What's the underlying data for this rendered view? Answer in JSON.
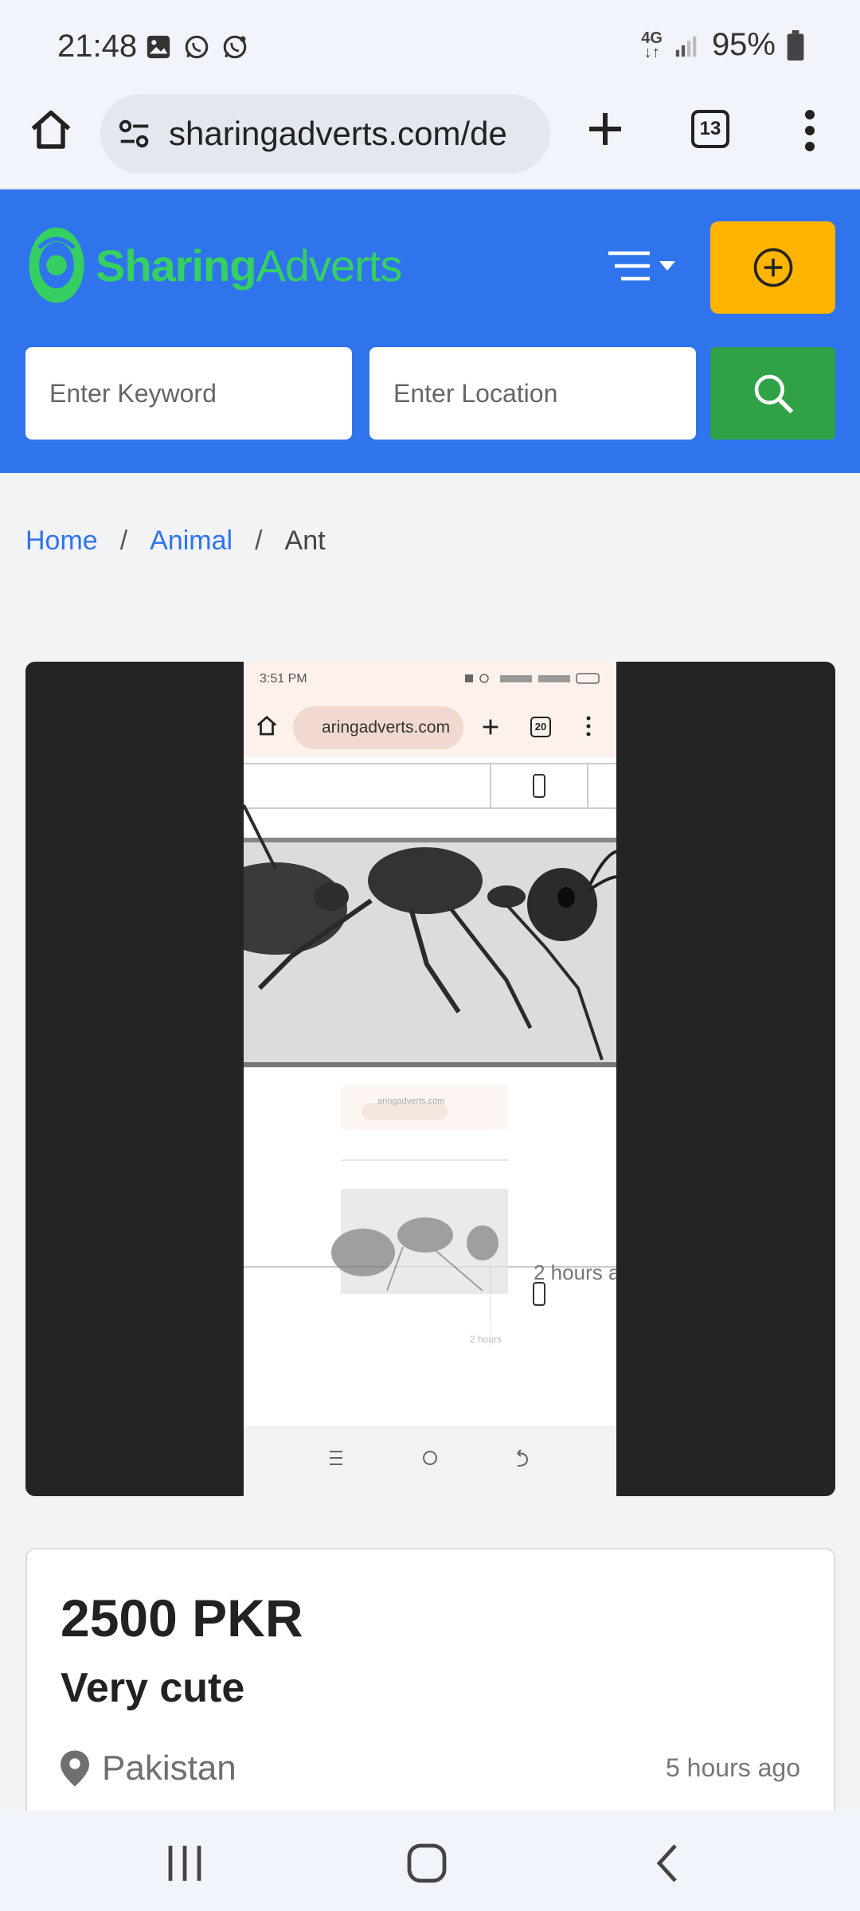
{
  "status_bar": {
    "time": "21:48",
    "network": "4G",
    "battery": "95%",
    "icons": [
      "gallery-icon",
      "whatsapp-icon",
      "whatsapp-business-icon",
      "signal-icon",
      "battery-icon"
    ]
  },
  "browser": {
    "url": "sharingadverts.com/de",
    "tab_count": "13",
    "icons": [
      "home-icon",
      "site-settings-icon",
      "new-tab-icon",
      "more-icon"
    ]
  },
  "header": {
    "logo_part1": "Sharing",
    "logo_part2": "Adverts",
    "keyword_placeholder": "Enter Keyword",
    "location_placeholder": "Enter Location",
    "colors": {
      "header_bg": "#2f74ec",
      "post_button": "#ffb400",
      "search_button": "#2fa146",
      "logo": "#35d061"
    }
  },
  "breadcrumb": {
    "items": [
      {
        "label": "Home"
      },
      {
        "label": "Animal"
      },
      {
        "label": "Ant"
      }
    ],
    "separator": "/"
  },
  "image": {
    "inner_time": "3:51 PM",
    "inner_url": "aringadverts.com",
    "inner_tab_count": "20",
    "inner_time_ago": "2 hours a",
    "nested_url": "aringadverts.com",
    "nested_time_ago": "2 hours"
  },
  "listing": {
    "price": "2500 PKR",
    "title": "Very cute",
    "location": "Pakistan",
    "posted": "5 hours ago"
  }
}
